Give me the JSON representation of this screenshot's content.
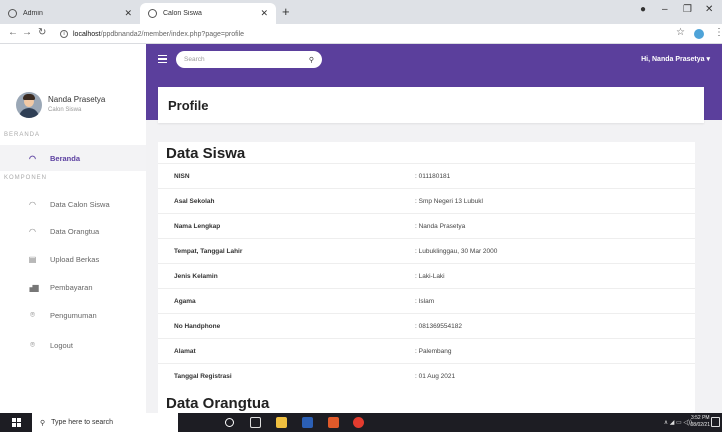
{
  "browser": {
    "tabs": [
      {
        "label": "Admin",
        "active": false
      },
      {
        "label": "Calon Siswa",
        "active": true
      }
    ],
    "new_tab": "+",
    "url_host": "localhost",
    "url_path": "/ppdbnanda2/member/index.php?page=profile"
  },
  "sidebar": {
    "user_name": "Nanda Prasetya",
    "user_role": "Calon Siswa",
    "section_main": "BERANDA",
    "section_components": "KOMPONEN",
    "items": [
      {
        "label": "Beranda",
        "active": true
      },
      {
        "label": "Data Calon Siswa",
        "active": false
      },
      {
        "label": "Data Orangtua",
        "active": false
      },
      {
        "label": "Upload Berkas",
        "active": false
      },
      {
        "label": "Pembayaran",
        "active": false
      },
      {
        "label": "Pengumuman",
        "active": false
      },
      {
        "label": "Logout",
        "active": false
      }
    ]
  },
  "topbar": {
    "search_placeholder": "Search",
    "greeting": "Hi, Nanda Prasetya ▾"
  },
  "page": {
    "title": "Profile"
  },
  "data_siswa": {
    "heading": "Data Siswa",
    "rows": [
      {
        "label": "NISN",
        "value": ": 011180181"
      },
      {
        "label": "Asal Sekolah",
        "value": ": Smp Negeri 13 Lubukl"
      },
      {
        "label": "Nama Lengkap",
        "value": ": Nanda Prasetya"
      },
      {
        "label": "Tempat, Tanggal Lahir",
        "value": ": Lubuklinggau, 30 Mar 2000"
      },
      {
        "label": "Jenis Kelamin",
        "value": ": Laki-Laki"
      },
      {
        "label": "Agama",
        "value": ": Islam"
      },
      {
        "label": "No Handphone",
        "value": ": 081369554182"
      },
      {
        "label": "Alamat",
        "value": ": Palembang"
      },
      {
        "label": "Tanggal Registrasi",
        "value": ": 01 Aug 2021"
      }
    ]
  },
  "data_orangtua": {
    "heading": "Data Orangtua"
  },
  "taskbar": {
    "search_placeholder": "Type here to search",
    "time": "3:52 PM",
    "date": "08/02/21"
  },
  "colors": {
    "accent": "#5b3f9c",
    "taskbar": "#1d1d23"
  }
}
